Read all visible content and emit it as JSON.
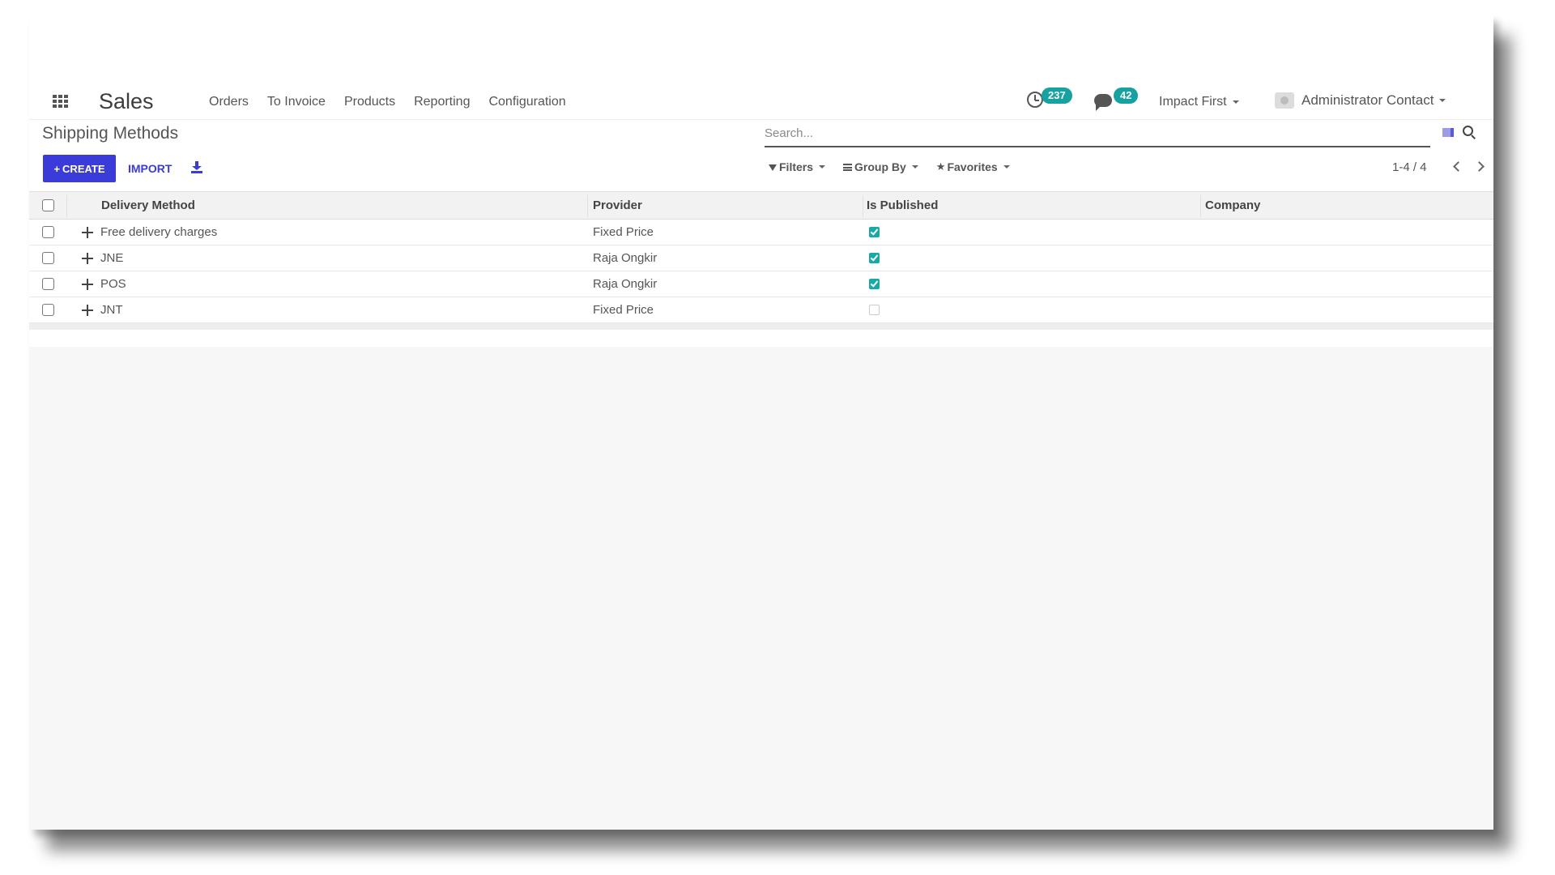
{
  "navbar": {
    "app_name": "Sales",
    "menu": [
      "Orders",
      "To Invoice",
      "Products",
      "Reporting",
      "Configuration"
    ],
    "activity_count": "237",
    "message_count": "42",
    "company": "Impact First",
    "user": "Administrator Contact"
  },
  "control": {
    "title": "Shipping Methods",
    "create_label": "CREATE",
    "import_label": "IMPORT",
    "search_placeholder": "Search...",
    "filters_label": "Filters",
    "groupby_label": "Group By",
    "favorites_label": "Favorites",
    "pager": "1-4 / 4"
  },
  "table": {
    "headers": [
      "Delivery Method",
      "Provider",
      "Is Published",
      "Company"
    ],
    "rows": [
      {
        "name": "Free delivery charges",
        "provider": "Fixed Price",
        "published": true,
        "company": ""
      },
      {
        "name": "JNE",
        "provider": "Raja Ongkir",
        "published": true,
        "company": ""
      },
      {
        "name": "POS",
        "provider": "Raja Ongkir",
        "published": true,
        "company": ""
      },
      {
        "name": "JNT",
        "provider": "Fixed Price",
        "published": false,
        "company": ""
      }
    ]
  },
  "colors": {
    "primary": "#3b3bd9",
    "badge": "#17a2a2",
    "check": "#19a8a8"
  },
  "icons": [
    "apps-icon",
    "clock-icon",
    "chat-icon",
    "download-icon",
    "search-icon",
    "filter-icon",
    "group-icon",
    "star-icon",
    "drag-handle-icon"
  ]
}
